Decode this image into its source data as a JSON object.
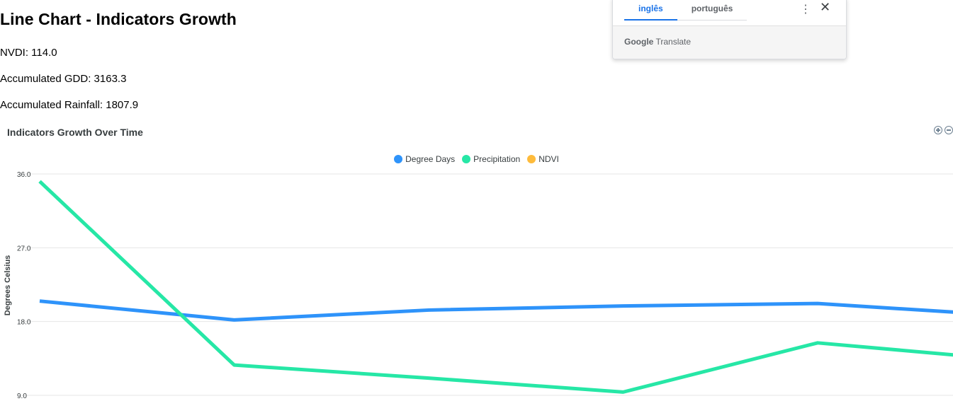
{
  "page": {
    "title": "Line Chart - Indicators Growth",
    "stats": [
      "NVDI: 114.0",
      "Accumulated GDD: 3163.3",
      "Accumulated Rainfall: 1807.9"
    ]
  },
  "translate": {
    "tabs": [
      "inglês",
      "português"
    ],
    "brand_google": "Google",
    "brand_product": "Translate",
    "menu_icon": "more-vert-icon",
    "close_icon": "close-icon"
  },
  "chart_data": {
    "type": "line",
    "title": "Indicators Growth Over Time",
    "ylabel": "Degrees Celsius",
    "xlabel": "",
    "ylim": [
      9.0,
      36.0
    ],
    "yticks": [
      "36.0",
      "27.0",
      "18.0",
      "9.0"
    ],
    "grid": true,
    "legend_position": "top-center",
    "x": [
      1,
      2,
      3,
      4,
      5,
      6
    ],
    "series": [
      {
        "name": "Degree Days",
        "color": "#2e93fa",
        "values": [
          20.5,
          18.2,
          19.4,
          19.9,
          20.2,
          18.7
        ]
      },
      {
        "name": "Precipitation",
        "color": "#26e7a6",
        "values": [
          35.1,
          12.7,
          11.1,
          9.4,
          15.4,
          13.3
        ]
      },
      {
        "name": "NDVI",
        "color": "#febb3b",
        "values": []
      }
    ]
  }
}
